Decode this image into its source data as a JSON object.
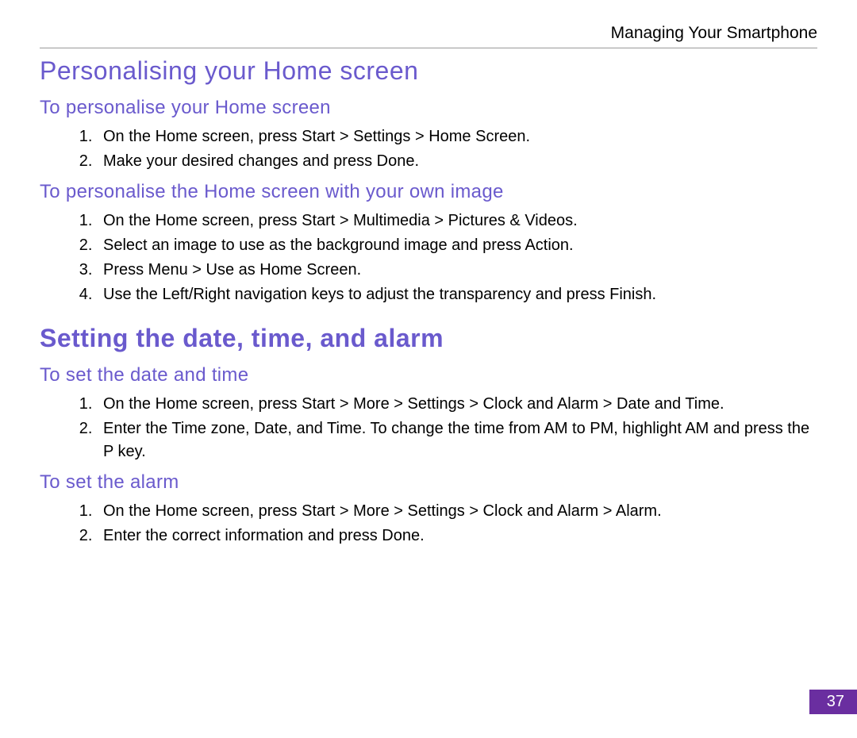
{
  "header": {
    "title": "Managing Your Smartphone"
  },
  "sections": {
    "s1": {
      "heading": "Personalising your Home screen",
      "sub1": {
        "heading": "To personalise your Home screen",
        "items": [
          "On the Home screen, press Start > Settings > Home Screen.",
          "Make your desired changes and press Done."
        ]
      },
      "sub2": {
        "heading": "To personalise the Home screen with your own image",
        "items": [
          "On the Home screen, press Start  > Multimedia > Pictures & Videos.",
          "Select an image to use as the background image and press Action.",
          "Press Menu > Use as Home Screen.",
          "Use the Left/Right navigation keys to adjust the transparency and press Finish."
        ]
      }
    },
    "s2": {
      "heading": "Setting the date, time, and alarm",
      "sub1": {
        "heading": "To set the date and time",
        "items": [
          "On the Home screen, press Start  > More > Settings > Clock and Alarm > Date and Time.",
          "Enter the Time zone, Date, and Time. To change the time from AM to PM, highlight AM and press the P key."
        ]
      },
      "sub2": {
        "heading": "To set the alarm",
        "items": [
          "On the Home screen, press Start  > More > Settings > Clock and Alarm > Alarm.",
          "Enter the correct information and press Done."
        ]
      }
    }
  },
  "page_number": "37"
}
